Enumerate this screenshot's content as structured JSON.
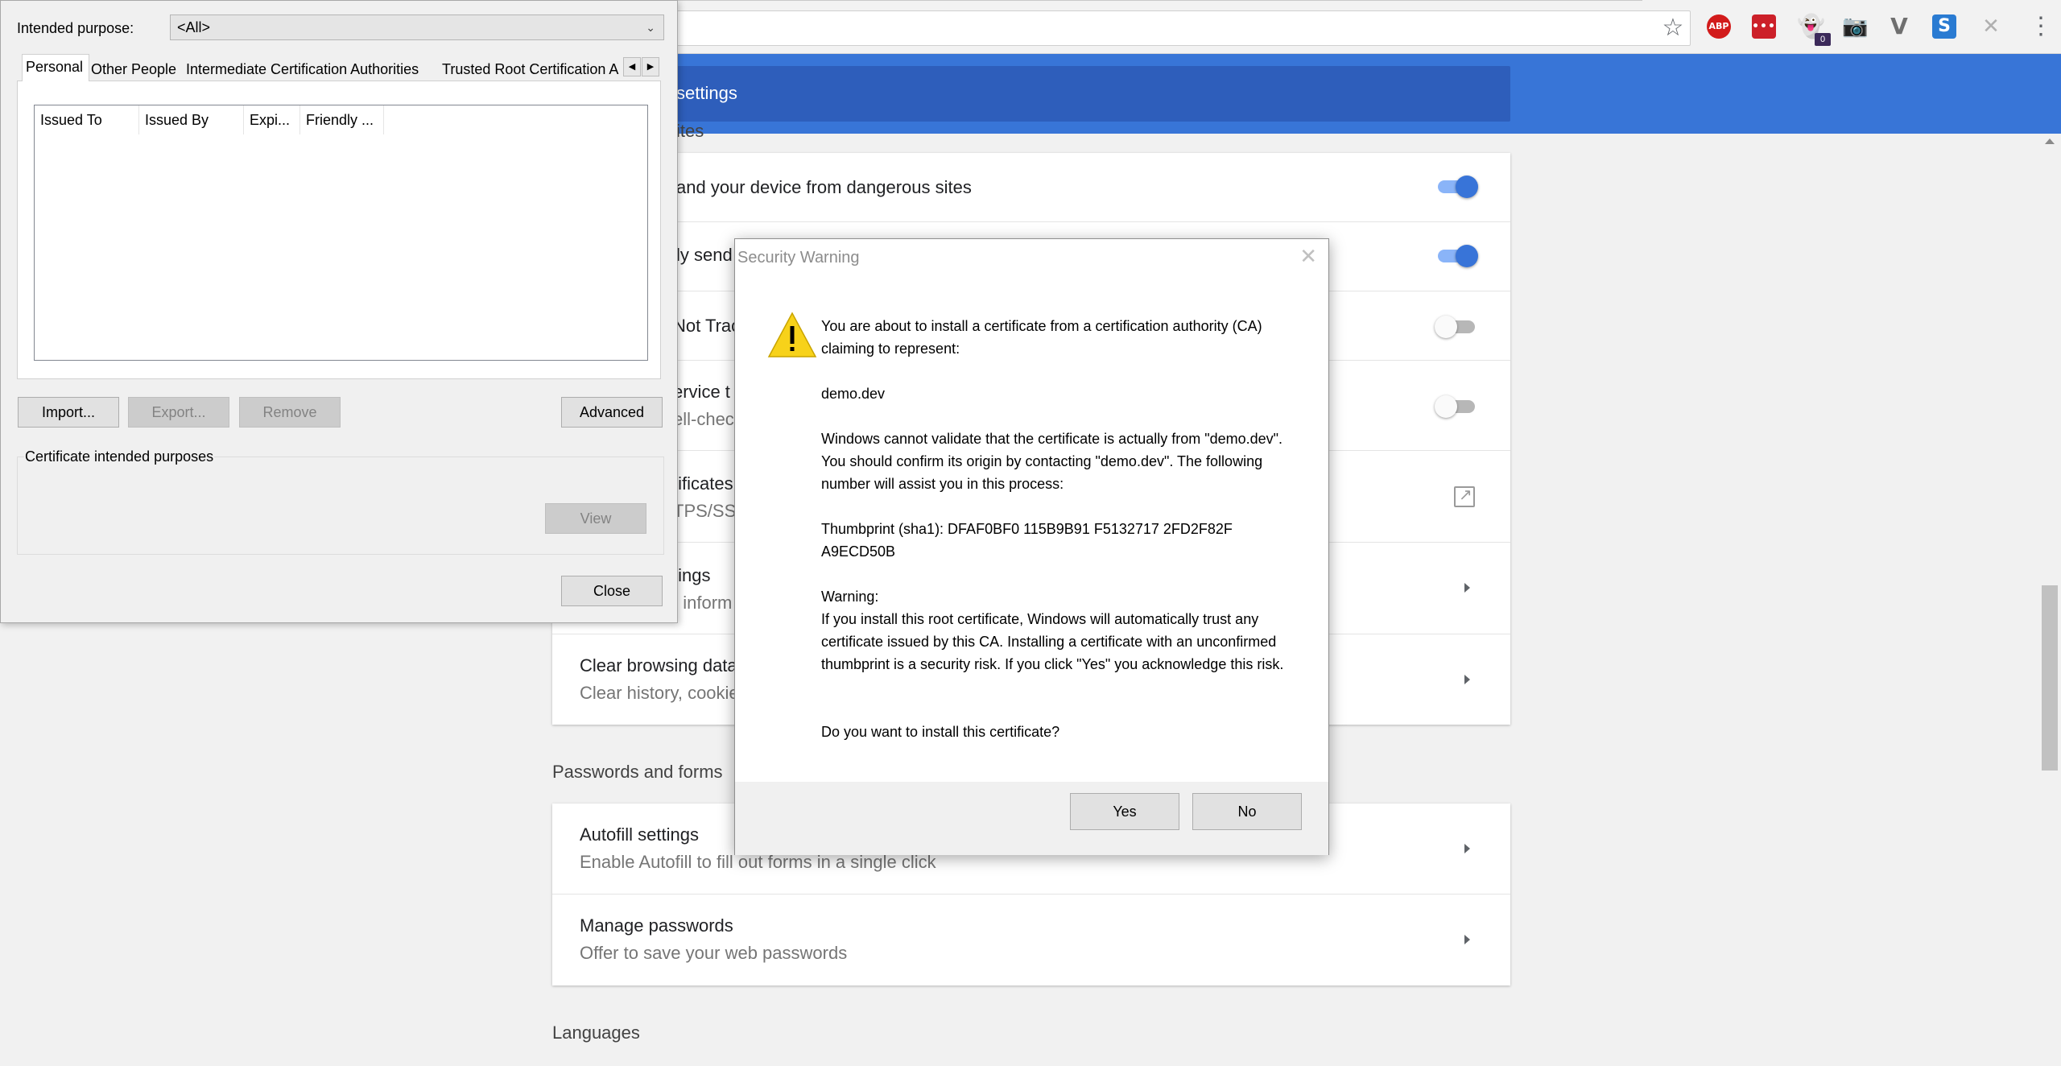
{
  "browser": {
    "extensions": [
      {
        "name": "abp-icon",
        "label": "ABP"
      },
      {
        "name": "lastpass-icon",
        "label": "•••"
      },
      {
        "name": "ghostery-icon",
        "label": "👻",
        "badge": "0"
      },
      {
        "name": "camera-icon",
        "label": "📷"
      },
      {
        "name": "vimium-icon",
        "label": "V"
      },
      {
        "name": "s-extension-icon",
        "label": "S"
      },
      {
        "name": "x-extension-icon",
        "label": "✕"
      }
    ]
  },
  "settings": {
    "header_title": "settings",
    "privacy_section_partial": "ites",
    "rows": {
      "safe_browsing": "and your device from dangerous sites",
      "send_stats": "ly send",
      "do_not_track": "Not Trac",
      "spell_title": "ervice t",
      "spell_sub": "ell-check",
      "certificates_title": "tificates",
      "certificates_sub": "TPS/SS",
      "content_title": "tings",
      "content_sub": "t inform",
      "clear_title": "Clear browsing data",
      "clear_sub": "Clear history, cookie"
    },
    "passwords_section_title": "Passwords and forms",
    "autofill_title": "Autofill settings",
    "autofill_sub": "Enable Autofill to fill out forms in a single click",
    "manage_passwords_title": "Manage passwords",
    "manage_passwords_sub": "Offer to save your web passwords",
    "languages_section_title": "Languages",
    "toggles": {
      "safe_browsing": true,
      "send_stats": true,
      "do_not_track": false,
      "spelling": false
    }
  },
  "certificates_dialog": {
    "intended_purpose_label": "Intended purpose:",
    "intended_purpose_value": "<All>",
    "tabs": [
      "Personal",
      "Other People",
      "Intermediate Certification Authorities",
      "Trusted Root Certification A"
    ],
    "active_tab": "Personal",
    "columns": [
      "Issued To",
      "Issued By",
      "Expi...",
      "Friendly ..."
    ],
    "buttons": {
      "import": "Import...",
      "export": "Export...",
      "remove": "Remove",
      "advanced": "Advanced",
      "view": "View",
      "close": "Close"
    },
    "purposes_group_label": "Certificate intended purposes"
  },
  "security_warning": {
    "title": "Security Warning",
    "intro": "You are about to install a certificate from a certification authority (CA) claiming to represent:",
    "domain": "demo.dev",
    "validate": "Windows cannot validate that the certificate is actually from \"demo.dev\". You should confirm its origin by contacting \"demo.dev\". The following number will assist you in this process:",
    "thumbprint": "Thumbprint (sha1): DFAF0BF0 115B9B91 F5132717 2FD2F82F A9ECD50B",
    "warning_label": "Warning:",
    "warning_text": "If you install this root certificate, Windows will automatically trust any certificate issued by this CA. Installing a certificate with an unconfirmed thumbprint is a security risk. If you click \"Yes\" you acknowledge this risk.",
    "question": "Do you want to install this certificate?",
    "yes_label": "Yes",
    "no_label": "No"
  }
}
